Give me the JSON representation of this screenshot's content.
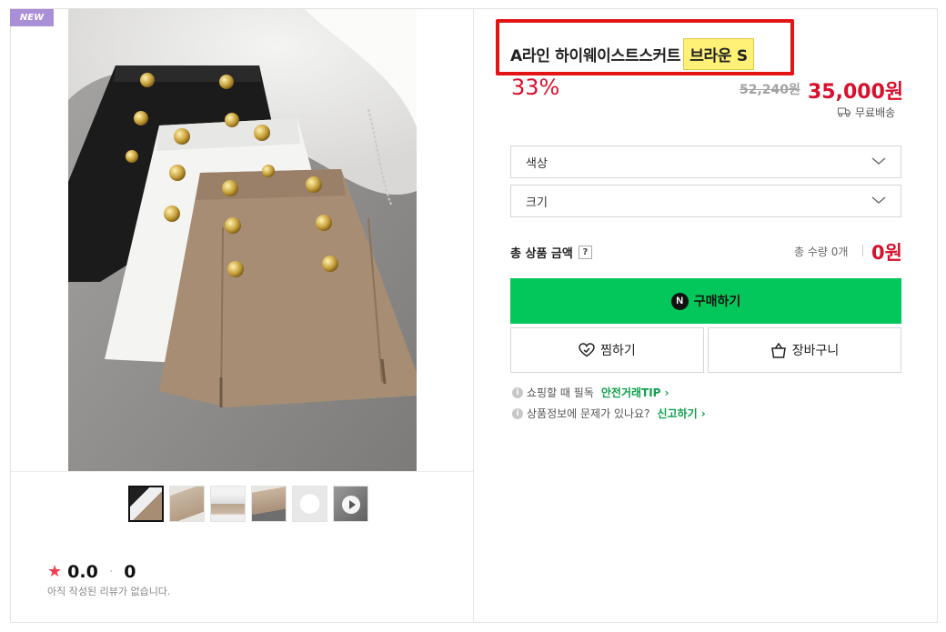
{
  "badge": {
    "new_label": "NEW"
  },
  "product": {
    "title_main": "A라인 하이웨이스트스커트",
    "title_option": "브라운 S",
    "discount": "33%",
    "original_price": "52,240원",
    "price": "35,000원",
    "shipping": "무료배송"
  },
  "options": [
    {
      "label": "색상"
    },
    {
      "label": "크기"
    }
  ],
  "total": {
    "label": "총 상품 금액",
    "help": "?",
    "quantity": "총 수량 0개",
    "amount": "0원"
  },
  "buttons": {
    "buy": "구매하기",
    "buy_logo": "N",
    "wishlist": "찜하기",
    "cart": "장바구니"
  },
  "info": {
    "line1_text": "쇼핑할 때 필독",
    "line1_link": "안전거래TIP",
    "line2_text": "상품정보에 문제가 있나요?",
    "line2_link": "신고하기"
  },
  "review": {
    "score": "0.0",
    "count": "0",
    "empty": "아직 작성된 리뷰가 없습니다."
  },
  "colors": {
    "accent_green": "#03c75a",
    "price_red": "#d8102d",
    "highlight_red_box": "#e31414",
    "highlight_yellow": "#fff176"
  }
}
